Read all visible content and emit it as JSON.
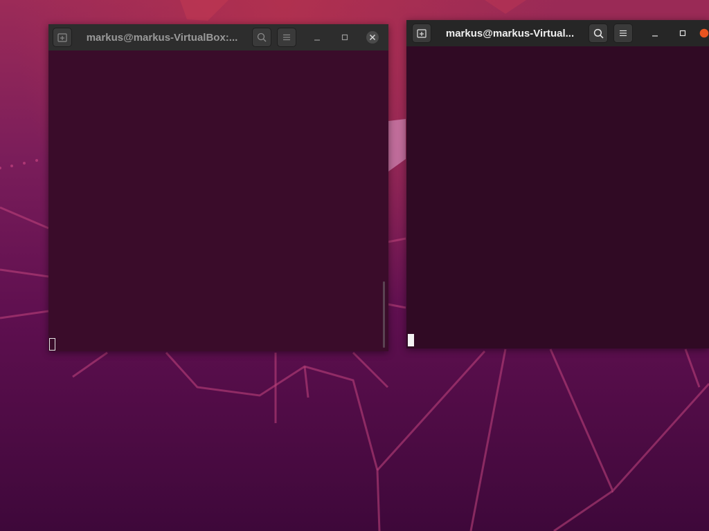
{
  "desktop": {
    "wallpaper": "ubuntu-focal-fossa",
    "colors": {
      "top": "#9c2b58",
      "bottom": "#3e083a",
      "accent_orange": "#e95420"
    }
  },
  "windows": [
    {
      "title": "markus@markus-VirtualBox:...",
      "state": "unfocused",
      "colors": {
        "terminal_bg": "#3a0c2a",
        "titlebar": "#2d2d2d"
      },
      "icons": [
        "new-tab-icon",
        "search-icon",
        "hamburger-menu-icon",
        "minimize-icon",
        "maximize-icon",
        "close-icon"
      ]
    },
    {
      "title": "markus@markus-Virtual...",
      "state": "focused",
      "colors": {
        "terminal_bg": "#300a24",
        "titlebar": "#262626"
      },
      "icons": [
        "new-tab-icon",
        "search-icon",
        "hamburger-menu-icon",
        "minimize-icon",
        "maximize-icon",
        "close-icon"
      ]
    }
  ]
}
